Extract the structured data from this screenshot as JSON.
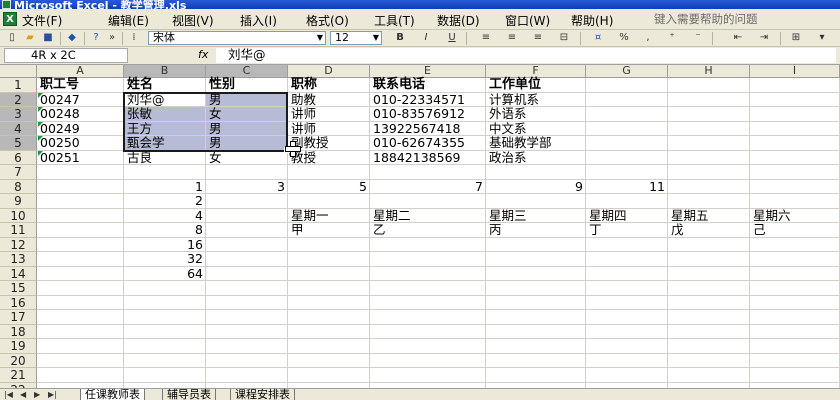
{
  "window": {
    "title": "Microsoft Excel - 教学管理.xls"
  },
  "menu": {
    "items": [
      "文件(F)",
      "编辑(E)",
      "视图(V)",
      "插入(I)",
      "格式(O)",
      "工具(T)",
      "数据(D)",
      "窗口(W)",
      "帮助(H)"
    ],
    "help_placeholder": "键入需要帮助的问题"
  },
  "toolbar": {
    "font": "宋体",
    "size": "12",
    "bold": "B",
    "italic": "I",
    "underline": "U",
    "percent": "%"
  },
  "formula_bar": {
    "name_box": "4R x 2C",
    "fx": "fx",
    "content": "刘华@"
  },
  "columns": [
    "A",
    "B",
    "C",
    "D",
    "E",
    "F",
    "G",
    "H",
    "I"
  ],
  "rows": [
    "1",
    "2",
    "3",
    "4",
    "5",
    "6",
    "7",
    "8",
    "9",
    "10",
    "11",
    "12",
    "13",
    "14",
    "15",
    "16",
    "17",
    "18",
    "19",
    "20",
    "21",
    "22"
  ],
  "cells": {
    "r1": {
      "A": "职工号",
      "B": "姓名",
      "C": "性别",
      "D": "职称",
      "E": "联系电话",
      "F": "工作单位"
    },
    "r2": {
      "A": "00247",
      "B": "刘华@",
      "C": "男",
      "D": "助教",
      "E": "010-22334571",
      "F": "计算机系"
    },
    "r3": {
      "A": "00248",
      "B": "张敏",
      "C": "女",
      "D": "讲师",
      "E": "010-83576912",
      "F": "外语系"
    },
    "r4": {
      "A": "00249",
      "B": "王方",
      "C": "男",
      "D": "讲师",
      "E": "13922567418",
      "F": "中文系"
    },
    "r5": {
      "A": "00250",
      "B": "甄会学",
      "C": "男",
      "D": "副教授",
      "E": "010-62674355",
      "F": "基础教学部"
    },
    "r6": {
      "A": "00251",
      "B": "古良",
      "C": "女",
      "D": "教授",
      "E": "18842138569",
      "F": "政治系"
    },
    "r8": {
      "B": "1",
      "C": "3",
      "D": "5",
      "E": "7",
      "F": "9",
      "G": "11"
    },
    "r9": {
      "B": "2"
    },
    "r10": {
      "B": "4",
      "D": "星期一",
      "E": "星期二",
      "F": "星期三",
      "G": "星期四",
      "H": "星期五",
      "I": "星期六"
    },
    "r11": {
      "B": "8",
      "D": "甲",
      "E": "乙",
      "F": "丙",
      "G": "丁",
      "H": "戊",
      "I": "己"
    },
    "r12": {
      "B": "16"
    },
    "r13": {
      "B": "32"
    },
    "r14": {
      "B": "64"
    }
  },
  "sheets": {
    "tabs": [
      "任课教师表",
      "辅导员表",
      "课程安排表"
    ],
    "active": "任课教师表"
  }
}
